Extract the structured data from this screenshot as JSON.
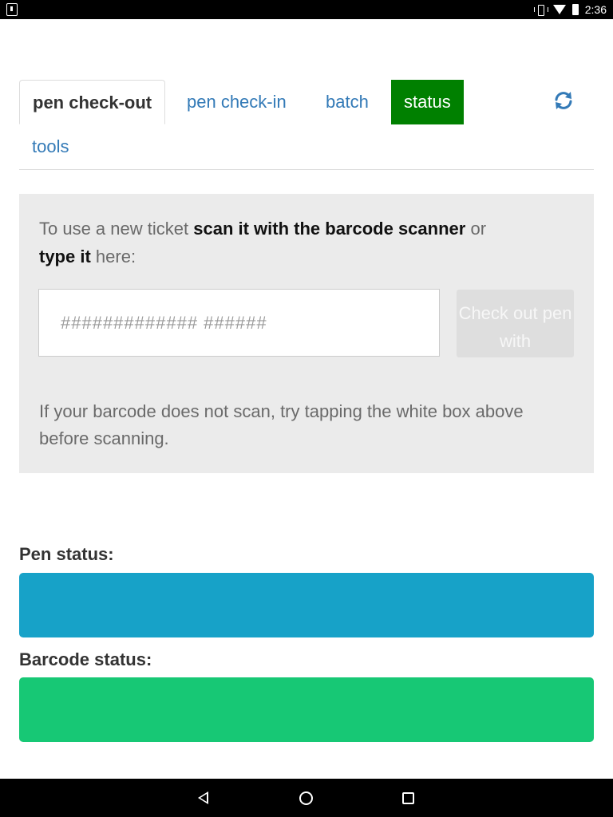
{
  "status_bar": {
    "time": "2:36"
  },
  "tabs": [
    {
      "label": "pen check-out",
      "active": true
    },
    {
      "label": "pen check-in",
      "active": false
    },
    {
      "label": "batch",
      "active": false
    },
    {
      "label": "status",
      "active": false
    },
    {
      "label": "tools",
      "active": false
    }
  ],
  "refresh_icon": "refresh-icon",
  "scan_panel": {
    "instruction_prefix": "To use a new ticket",
    "instruction_bold1": "scan it with the barcode scanner",
    "instruction_or": "or",
    "instruction_bold2": "type it",
    "instruction_suffix": "here:",
    "input_placeholder": "############# ######",
    "input_value": "",
    "checkout_button_label": "Check out pen with",
    "hint": "If your barcode does not scan, try tapping the white box above before scanning."
  },
  "pen_status": {
    "label": "Pen status:",
    "color": "#17a2c8"
  },
  "barcode_status": {
    "label": "Barcode status:",
    "color": "#17c875"
  },
  "colors": {
    "link": "#337ab7",
    "status_tab": "#008000"
  }
}
